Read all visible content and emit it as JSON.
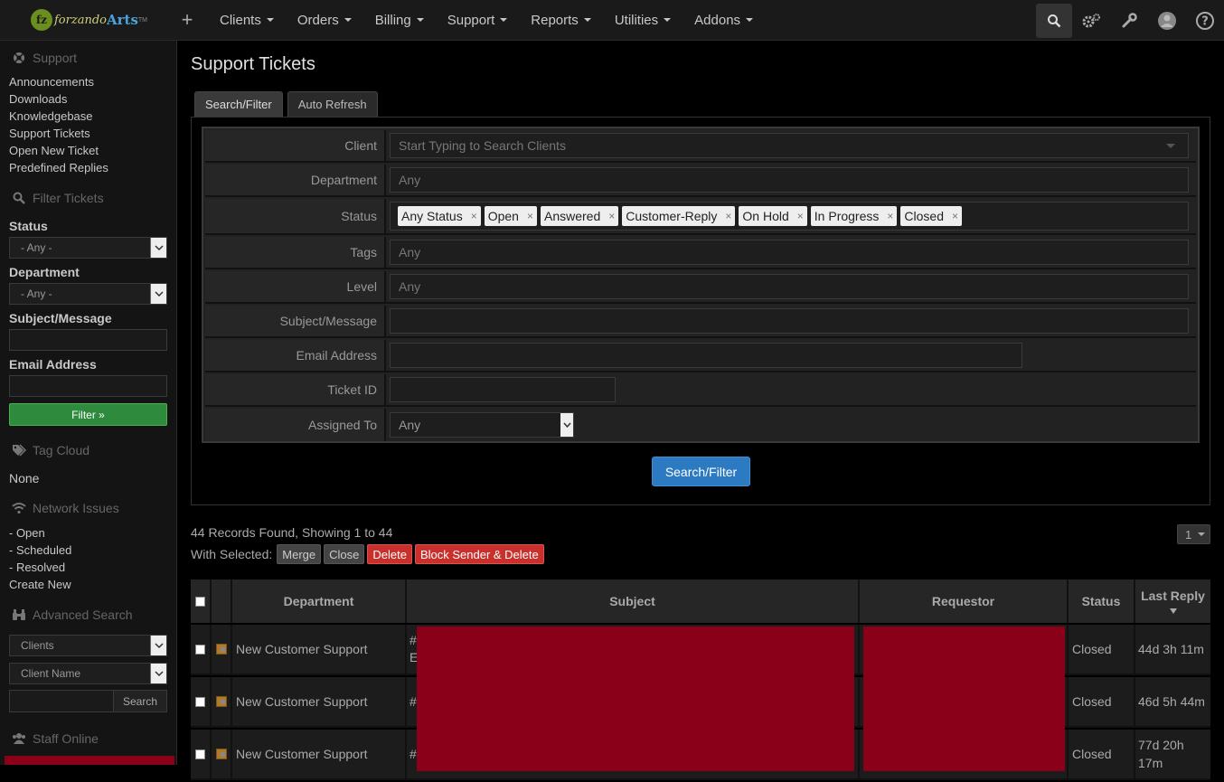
{
  "brand": {
    "mark": "fz",
    "word1": "forzando",
    "word2": "Arts",
    "tm": "TM"
  },
  "topnav": [
    {
      "label": "Clients"
    },
    {
      "label": "Orders"
    },
    {
      "label": "Billing"
    },
    {
      "label": "Support"
    },
    {
      "label": "Reports"
    },
    {
      "label": "Utilities"
    },
    {
      "label": "Addons"
    }
  ],
  "sidebar": {
    "support_head": "Support",
    "support_links": [
      "Announcements",
      "Downloads",
      "Knowledgebase",
      "Support Tickets",
      "Open New Ticket",
      "Predefined Replies"
    ],
    "filter_head": "Filter Tickets",
    "status_label": "Status",
    "status_value": "- Any -",
    "department_label": "Department",
    "department_value": "- Any -",
    "subject_label": "Subject/Message",
    "email_label": "Email Address",
    "filter_button": "Filter »",
    "tagcloud_head": "Tag Cloud",
    "tagcloud_value": "None",
    "network_head": "Network Issues",
    "network_links": [
      "- Open",
      "- Scheduled",
      "- Resolved",
      "Create New"
    ],
    "advsearch_head": "Advanced Search",
    "adv_type": "Clients",
    "adv_field": "Client Name",
    "adv_button": "Search",
    "staff_head": "Staff Online"
  },
  "main": {
    "title": "Support Tickets",
    "tabs": [
      "Search/Filter",
      "Auto Refresh"
    ],
    "form": {
      "client_label": "Client",
      "client_placeholder": "Start Typing to Search Clients",
      "department_label": "Department",
      "department_value": "Any",
      "status_label": "Status",
      "status_tags": [
        "Any Status",
        "Open",
        "Answered",
        "Customer-Reply",
        "On Hold",
        "In Progress",
        "Closed"
      ],
      "tags_label": "Tags",
      "tags_value": "Any",
      "level_label": "Level",
      "level_value": "Any",
      "subject_label": "Subject/Message",
      "email_label": "Email Address",
      "ticketid_label": "Ticket ID",
      "assigned_label": "Assigned To",
      "assigned_value": "Any"
    },
    "search_button": "Search/Filter",
    "records_text": "44 Records Found, Showing 1 to 44",
    "with_selected": "With Selected:",
    "bulk_buttons": [
      "Merge",
      "Close",
      "Delete",
      "Block Sender & Delete"
    ],
    "page_number": "1"
  },
  "table": {
    "headers": {
      "department": "Department",
      "subject": "Subject",
      "requestor": "Requestor",
      "status": "Status",
      "last_reply": "Last Reply"
    },
    "rows": [
      {
        "department": "New Customer Support",
        "subject_prefix": "#",
        "subject_line2": "E",
        "status": "Closed",
        "last_reply": "44d 3h 11m"
      },
      {
        "department": "New Customer Support",
        "subject_prefix": "#",
        "subject_line2": "",
        "status": "Closed",
        "last_reply": "46d 5h 44m"
      },
      {
        "department": "New Customer Support",
        "subject_prefix": "#",
        "subject_line2": "",
        "status": "Closed",
        "last_reply": "77d 20h 17m"
      }
    ]
  },
  "colors": {
    "redaction": "#8b0019",
    "primary": "#2c7ac2",
    "success": "#2e8b3e",
    "danger": "#c9302c"
  }
}
